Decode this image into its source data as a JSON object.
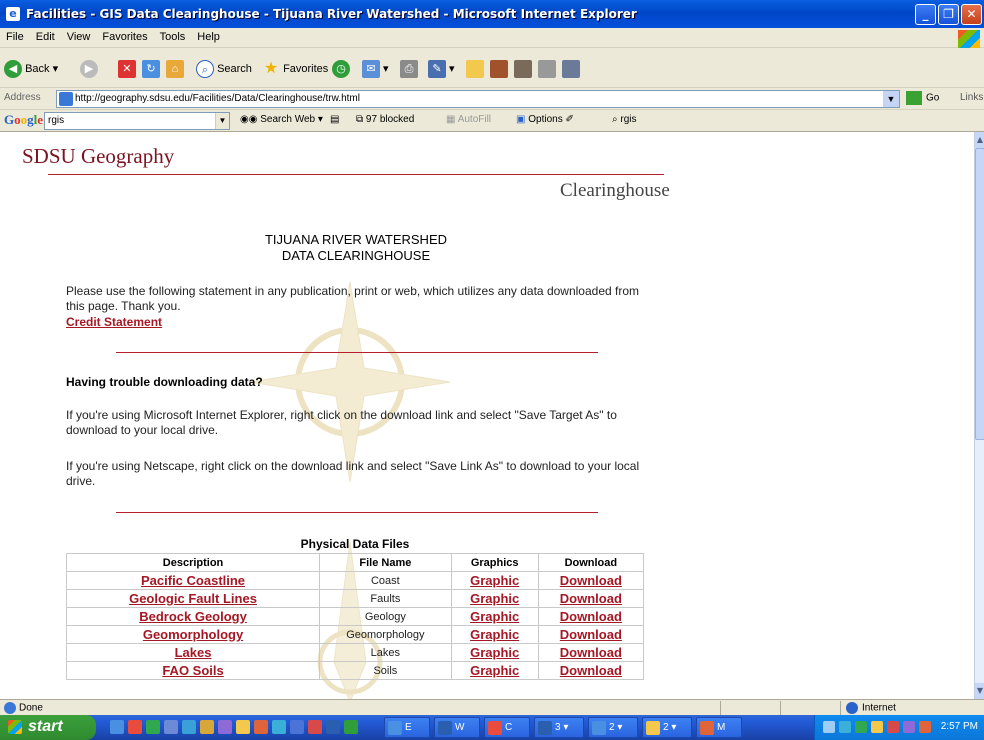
{
  "window": {
    "title": "Facilities - GIS Data Clearinghouse - Tijuana River Watershed - Microsoft Internet Explorer",
    "controls": [
      "_",
      "❐",
      "✕"
    ]
  },
  "menu": [
    "File",
    "Edit",
    "View",
    "Favorites",
    "Tools",
    "Help"
  ],
  "toolbar": {
    "back": "Back",
    "search": "Search",
    "favorites": "Favorites"
  },
  "address": {
    "label": "Address",
    "url": "http://geography.sdsu.edu/Facilities/Data/Clearinghouse/trw.html",
    "go": "Go",
    "links": "Links"
  },
  "google": {
    "logo": "Google",
    "query": "rgis",
    "search_web": "Search Web",
    "blocked": "97 blocked",
    "autofill": "AutoFill",
    "options": "Options",
    "rgis": "rgis"
  },
  "page": {
    "site_title": "SDSU Geography",
    "section": "Clearinghouse",
    "heading_line1": "TIJUANA RIVER WATERSHED",
    "heading_line2": "DATA CLEARINGHOUSE",
    "intro": "Please use the following statement in any publication, print or web, which utilizes any data downloaded from this page. Thank you.",
    "credit_link": "Credit Statement",
    "trouble_heading": "Having trouble downloading data?",
    "ie_help": "If you're using Microsoft Internet Explorer, right click on the download link and select \"Save Target As\" to download to your local drive.",
    "ns_help": "If you're using Netscape, right click on the download link and select \"Save Link As\" to download to your local drive.",
    "table_caption": "Physical Data Files",
    "table_headers": [
      "Description",
      "File Name",
      "Graphics",
      "Download"
    ],
    "rows": [
      {
        "desc": "Pacific Coastline",
        "file": "Coast",
        "graphic": "Graphic",
        "download": "Download"
      },
      {
        "desc": "Geologic Fault Lines",
        "file": "Faults",
        "graphic": "Graphic",
        "download": "Download"
      },
      {
        "desc": "Bedrock Geology",
        "file": "Geology",
        "graphic": "Graphic",
        "download": "Download"
      },
      {
        "desc": "Geomorphology",
        "file": "Geomorphology",
        "graphic": "Graphic",
        "download": "Download"
      },
      {
        "desc": "Lakes",
        "file": "Lakes",
        "graphic": "Graphic",
        "download": "Download"
      },
      {
        "desc": "FAO Soils",
        "file": "Soils",
        "graphic": "Graphic",
        "download": "Download"
      }
    ]
  },
  "status": {
    "text": "Done",
    "zone": "Internet"
  },
  "taskbar": {
    "start": "start",
    "tasks": [
      "E",
      "W",
      "C",
      "3",
      "2",
      "2",
      "M"
    ],
    "clock": "2:57 PM"
  },
  "colors": {
    "accent_red": "#a41825",
    "rule_red": "#b3202c",
    "title_blue": "#0047c8"
  }
}
